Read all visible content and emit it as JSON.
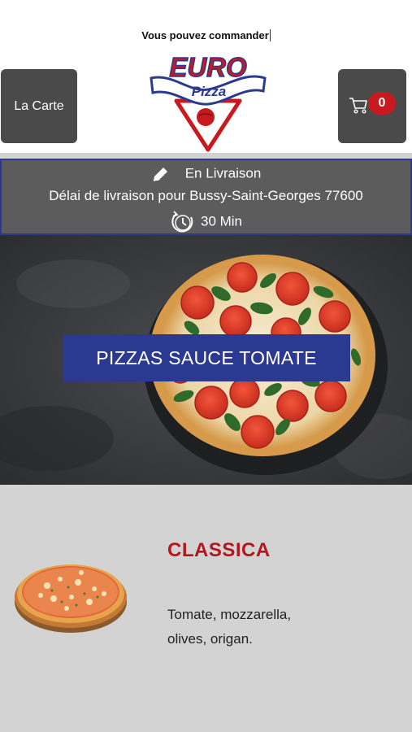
{
  "header": {
    "note": "Vous pouvez commander",
    "menu_button_label": "La Carte",
    "cart_count": "0",
    "logo": {
      "text_top": "EURO",
      "text_ribbon": "Pizza"
    }
  },
  "delivery": {
    "mode": "En Livraison",
    "area_text": "Délai de livraison pour Bussy-Saint-Georges 77600",
    "delay": "30 Min"
  },
  "hero": {
    "category_label": "PIZZAS SAUCE TOMATE"
  },
  "product": {
    "name": "CLASSICA",
    "description": "Tomate, mozzarella, olives, origan."
  },
  "colors": {
    "brand_blue": "#2b3990",
    "brand_red": "#c8191e",
    "button_gray": "#4a4a4a",
    "product_bg": "#d3d3d3"
  },
  "icons": [
    "pencil-icon",
    "clock-icon",
    "cart-icon"
  ]
}
